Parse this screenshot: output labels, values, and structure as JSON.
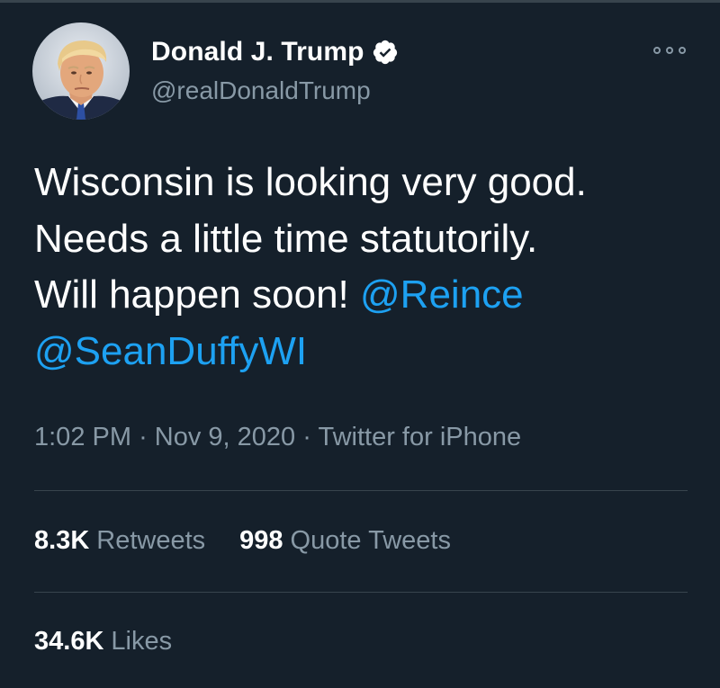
{
  "user": {
    "display_name": "Donald J. Trump",
    "handle": "@realDonaldTrump",
    "verified": true,
    "avatar": "profile-photo"
  },
  "tweet": {
    "lines": [
      [
        {
          "text": "Wisconsin is looking very good.",
          "mention": false
        }
      ],
      [
        {
          "text": "Needs a little time statutorily.",
          "mention": false
        }
      ],
      [
        {
          "text": "Will happen soon! ",
          "mention": false
        },
        {
          "text": "@Reince",
          "mention": true
        }
      ],
      [
        {
          "text": "@SeanDuffyWI",
          "mention": true
        }
      ]
    ]
  },
  "meta": {
    "time": "1:02 PM",
    "date": "Nov 9, 2020",
    "source": "Twitter for iPhone",
    "separator": "·"
  },
  "stats": {
    "retweets_count": "8.3K",
    "retweets_label": "Retweets",
    "quotes_count": "998",
    "quotes_label": "Quote Tweets",
    "likes_count": "34.6K",
    "likes_label": "Likes"
  },
  "icons": {
    "verified": "verified-badge-icon",
    "more": "more-options-icon"
  },
  "colors": {
    "background": "#15202b",
    "text": "#ffffff",
    "secondary": "#8899a6",
    "link": "#1da1f2",
    "divider": "#38444d"
  }
}
